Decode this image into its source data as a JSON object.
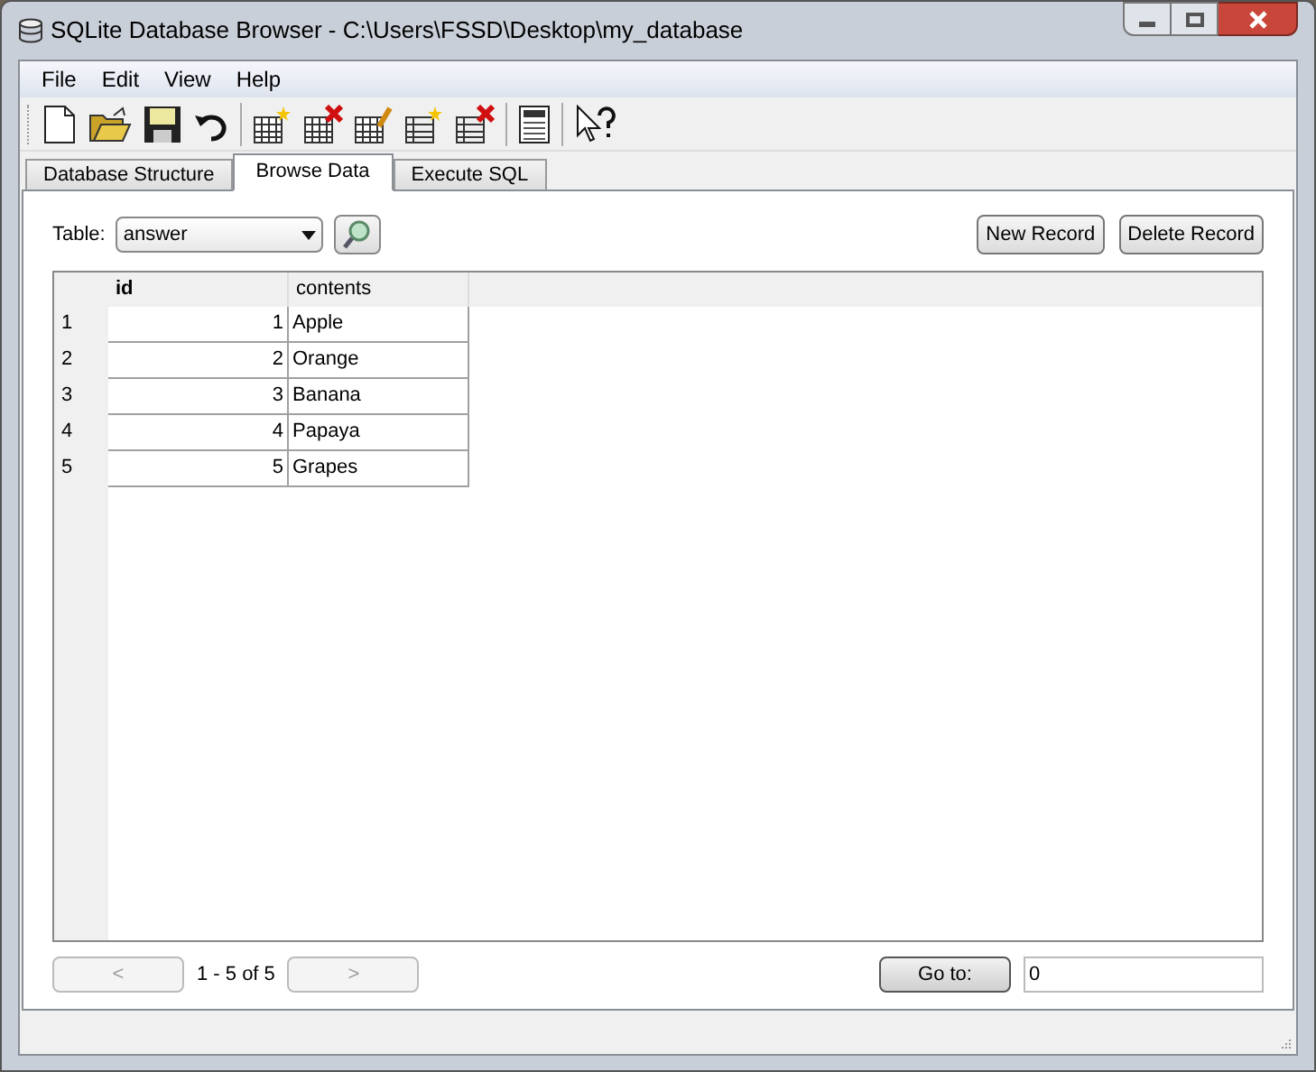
{
  "window": {
    "title": "SQLite Database Browser - C:\\Users\\FSSD\\Desktop\\my_database"
  },
  "menu": [
    "File",
    "Edit",
    "View",
    "Help"
  ],
  "tabs": [
    {
      "label": "Database Structure",
      "selected": false
    },
    {
      "label": "Browse Data",
      "selected": true
    },
    {
      "label": "Execute SQL",
      "selected": false
    }
  ],
  "table_picker": {
    "label": "Table:",
    "value": "answer"
  },
  "buttons": [
    "New Record",
    "Delete Record"
  ],
  "grid": {
    "columns": [
      {
        "label": "id",
        "bold": true
      },
      {
        "label": "contents",
        "bold": false
      }
    ],
    "rows": [
      {
        "number": "1",
        "cells": [
          "1",
          "Apple"
        ]
      },
      {
        "number": "2",
        "cells": [
          "2",
          "Orange"
        ]
      },
      {
        "number": "3",
        "cells": [
          "3",
          "Banana"
        ]
      },
      {
        "number": "4",
        "cells": [
          "4",
          "Papaya"
        ]
      },
      {
        "number": "5",
        "cells": [
          "5",
          "Grapes"
        ]
      }
    ]
  },
  "pager": {
    "previous": {
      "label": "<",
      "disabled": true
    },
    "range": "1 - 5 of 5",
    "next": {
      "label": ">",
      "disabled": true
    },
    "goto_button": "Go to:",
    "goto_value": "0"
  }
}
